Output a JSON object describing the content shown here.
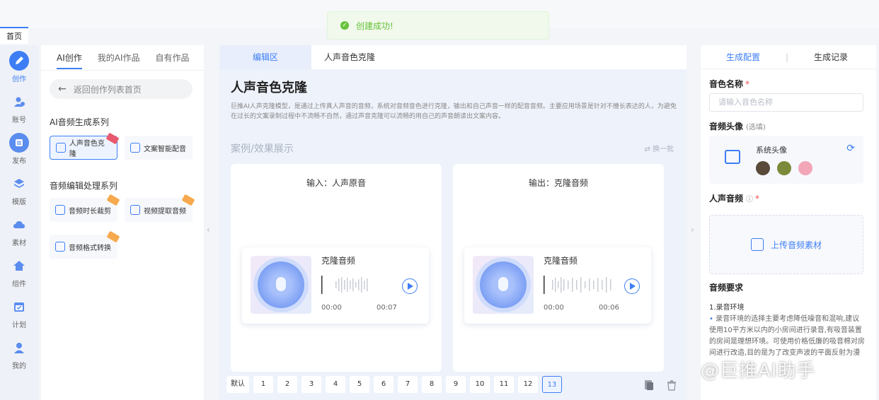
{
  "topbar": {
    "home_tab": "首页"
  },
  "toast": {
    "message": "创建成功!"
  },
  "rail": [
    {
      "label": "创作",
      "icon": "pen-icon"
    },
    {
      "label": "账号",
      "icon": "user-add-icon"
    },
    {
      "label": "发布",
      "icon": "publish-icon"
    },
    {
      "label": "模版",
      "icon": "layers-icon"
    },
    {
      "label": "素材",
      "icon": "cloud-icon"
    },
    {
      "label": "组件",
      "icon": "home-icon"
    },
    {
      "label": "计划",
      "icon": "calendar-icon"
    },
    {
      "label": "我的",
      "icon": "person-icon"
    }
  ],
  "panel2": {
    "tabs": [
      "AI创作",
      "我的AI作品",
      "自有作品"
    ],
    "back_label": "返回创作列表首页",
    "section1": "AI音频生成系列",
    "section2": "音频编辑处理系列",
    "tools": [
      "人声音色克隆",
      "文案智能配音",
      "音频时长裁剪",
      "视频提取音频",
      "音频格式转换"
    ]
  },
  "center": {
    "tabs": [
      "编辑区",
      "人声音色克隆"
    ],
    "title": "人声音色克隆",
    "desc": "巨推AI人声克隆模型，是通过上传真人声音的音频，系统对音频音色进行克隆，输出和自己声音一样的配音音频。主要应用场景是针对不擅长表达的人，为避免在过长的文案录制过程中不流畅不自然，通过声音克隆可以流畅的用自己的声音朗读出文案内容。",
    "case_title": "案例/效果展示",
    "swap_label": "换一批",
    "cards": [
      {
        "header": "输入：人声原音",
        "player_name": "克隆音频",
        "start": "00:00",
        "end": "00:07"
      },
      {
        "header": "输出：克隆音频",
        "player_name": "克隆音频",
        "start": "00:00",
        "end": "00:06"
      }
    ],
    "pager": [
      "默认",
      "1",
      "2",
      "3",
      "4",
      "5",
      "6",
      "7",
      "8",
      "9",
      "10",
      "11",
      "12",
      "13"
    ],
    "pager_active": "13"
  },
  "right": {
    "tabs": [
      "生成配置",
      "生成记录"
    ],
    "name_label": "音色名称",
    "name_placeholder": "请输入音色名称",
    "avatar_label": "音频头像",
    "avatar_optional": "(选填)",
    "avatar_title": "系统头像",
    "voice_label": "人声音频",
    "upload_label": "上传音频素材",
    "req_title": "音频要求",
    "req_sub": "1.录音环境",
    "req_text": "录音环境的选择主要考虑降低噪音和混响,建议使用10平方米以内的小房间进行录音,有吸音装置的房间是理想环境。可使用价格低廉的吸音棉对房间进行改造,目的是为了改变声波的平面反射为漫"
  },
  "watermark": "@巨推AI助手",
  "colors": {
    "accent": "#3d7ef5",
    "success": "#67c23a",
    "badge": "#f7a94d"
  }
}
